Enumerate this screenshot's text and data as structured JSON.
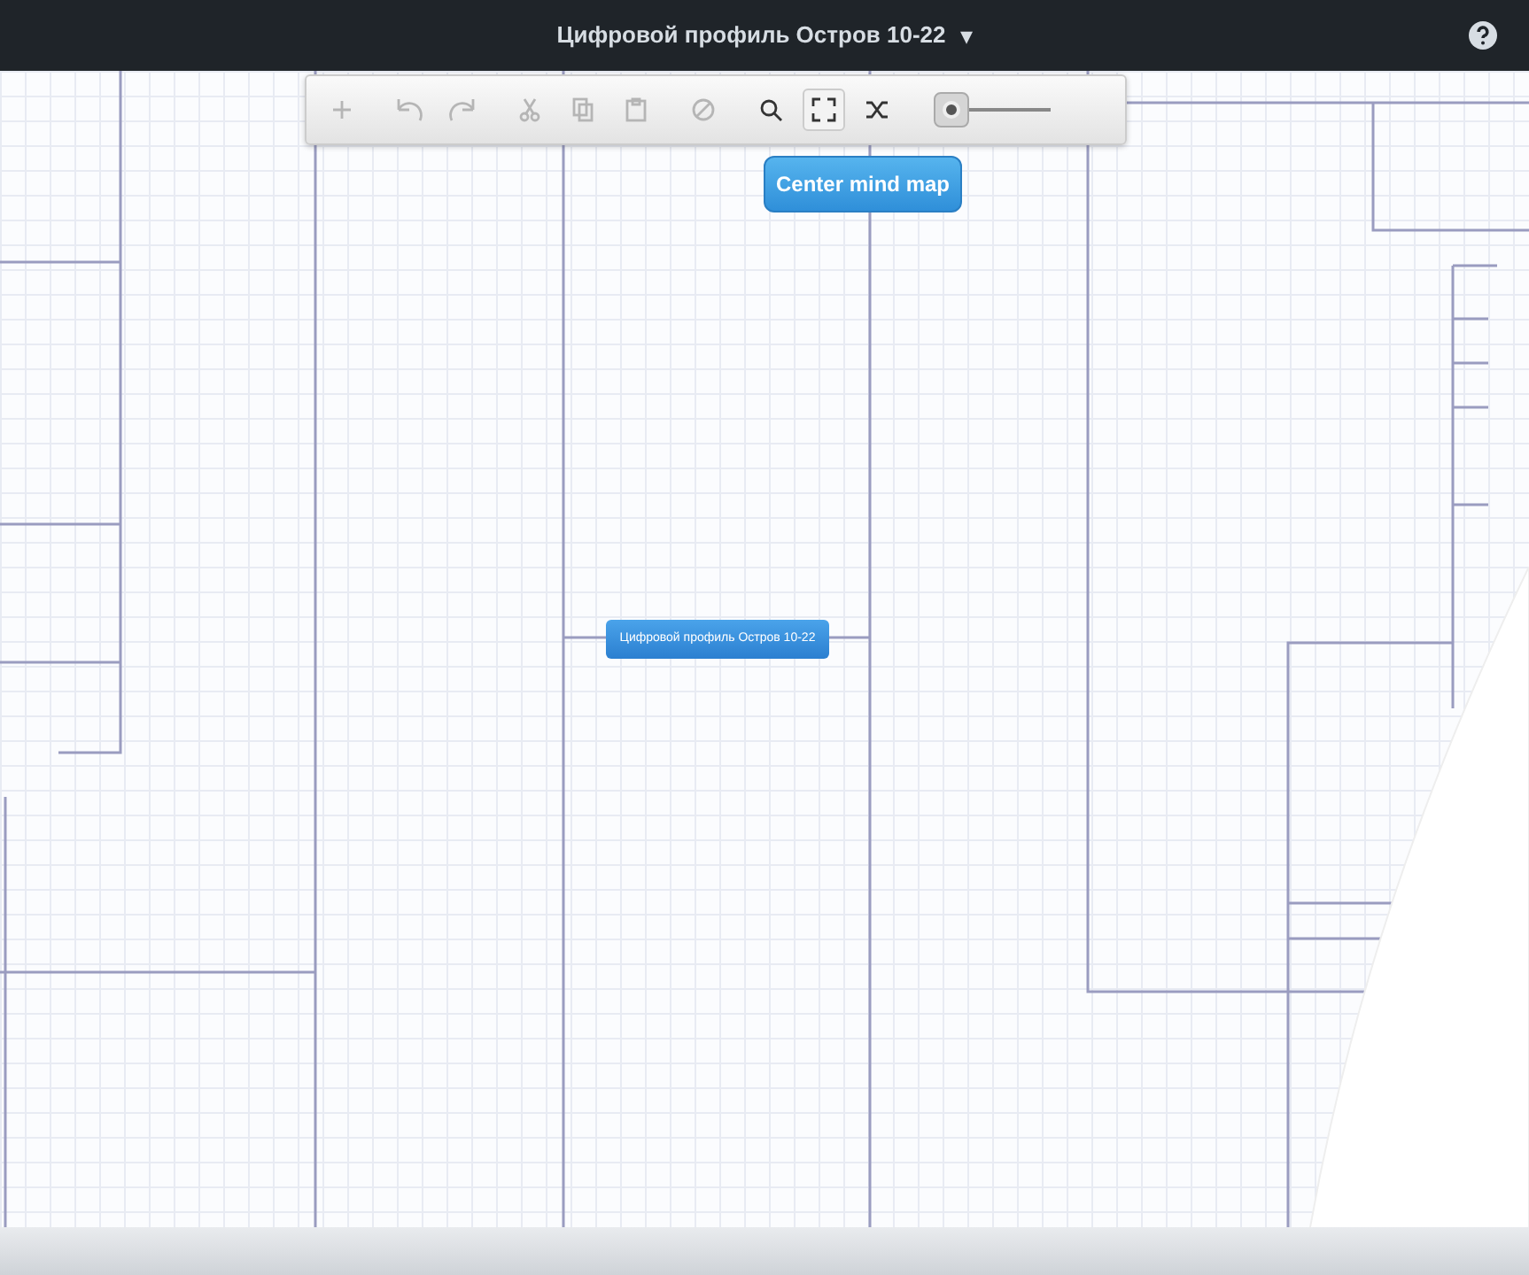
{
  "header": {
    "title": "Цифровой профиль Остров 10-22",
    "caret": "▾"
  },
  "toolbar": {
    "groups": [
      [
        {
          "kind": "add",
          "disabled": true,
          "selected": false
        }
      ],
      [
        {
          "kind": "undo",
          "disabled": true,
          "selected": false
        },
        {
          "kind": "redo",
          "disabled": true,
          "selected": false
        }
      ],
      [
        {
          "kind": "cut",
          "disabled": true,
          "selected": false
        },
        {
          "kind": "copy",
          "disabled": true,
          "selected": false
        },
        {
          "kind": "paste",
          "disabled": true,
          "selected": false
        }
      ],
      [
        {
          "kind": "delete",
          "disabled": true,
          "selected": false
        }
      ],
      [
        {
          "kind": "search",
          "disabled": false,
          "selected": false
        },
        {
          "kind": "fit",
          "disabled": false,
          "selected": true
        },
        {
          "kind": "shuffle",
          "disabled": false,
          "selected": false
        }
      ]
    ],
    "zoom": {
      "level": 0.12
    }
  },
  "center_button": {
    "label": "Center mind map"
  },
  "central_node": {
    "label": "Цифровой профиль Остров 10-22"
  }
}
